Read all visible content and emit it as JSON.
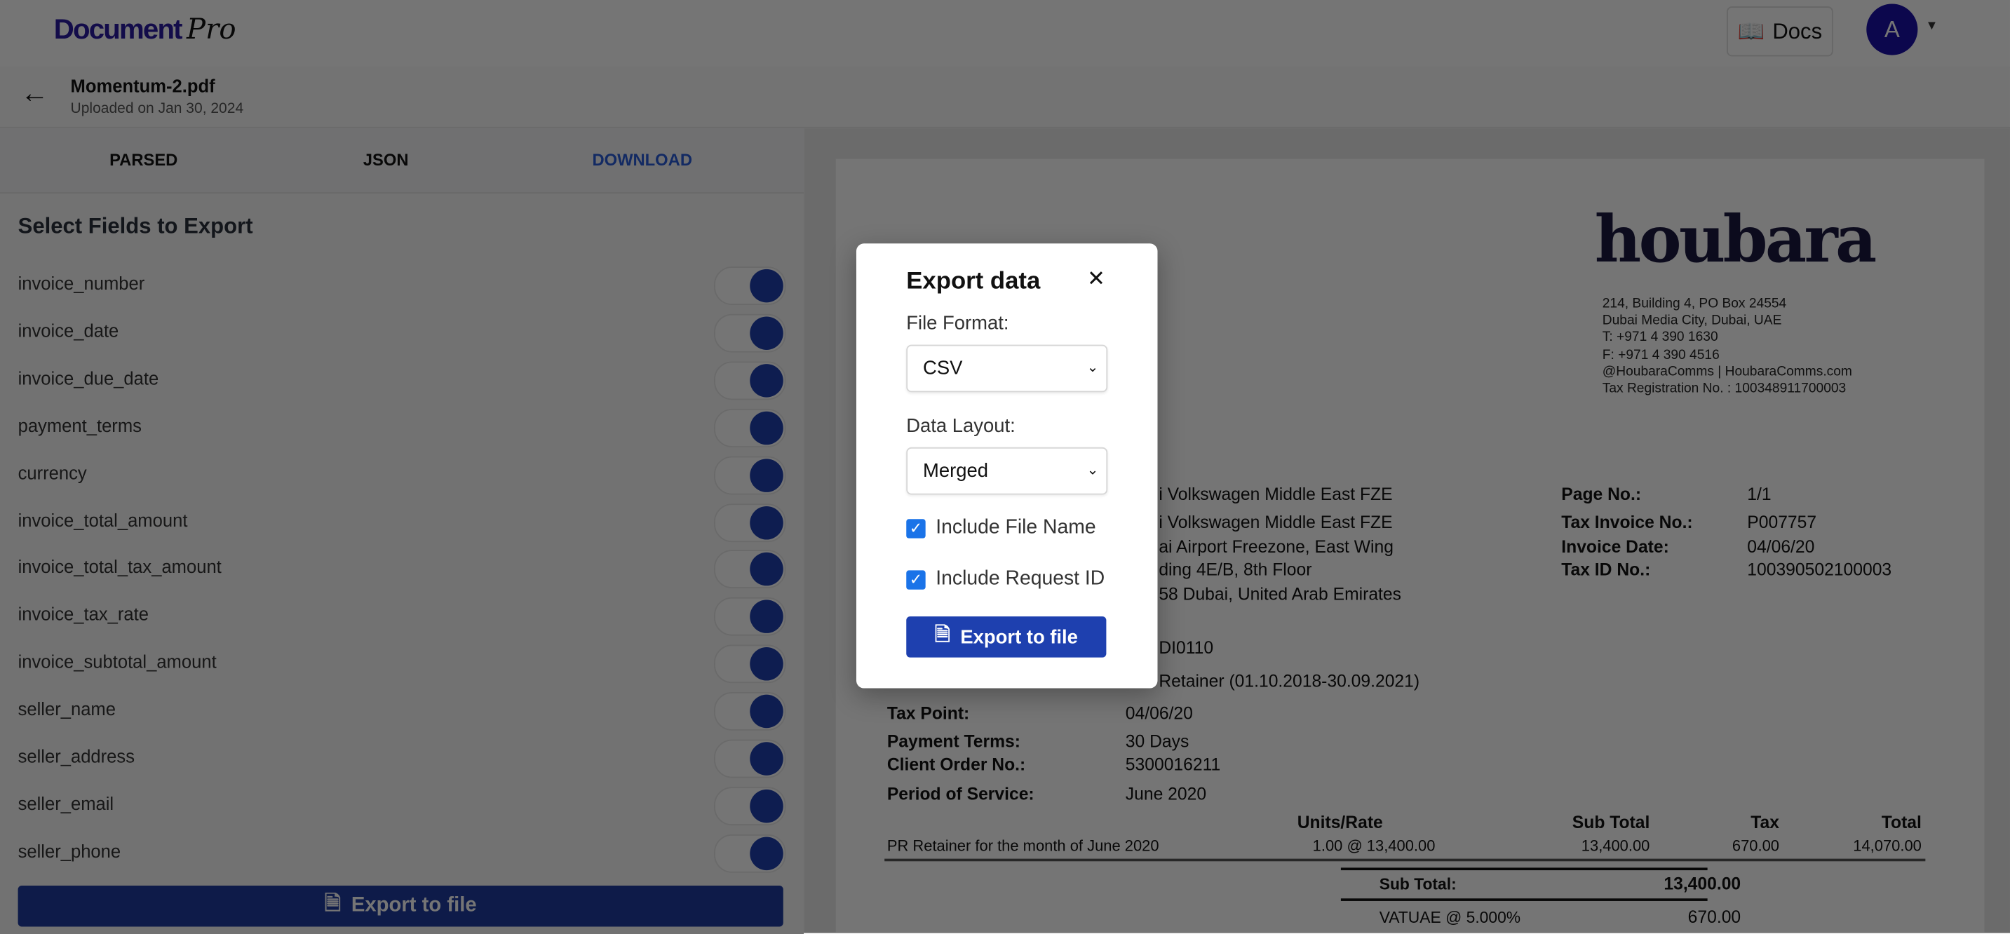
{
  "header": {
    "logo_main": "Document",
    "logo_script": "Pro",
    "docs_label": "Docs",
    "avatar_initial": "A"
  },
  "file": {
    "name": "Momentum-2.pdf",
    "uploaded": "Uploaded on Jan 30, 2024"
  },
  "tabs": [
    {
      "label": "PARSED"
    },
    {
      "label": "JSON"
    },
    {
      "label": "DOWNLOAD",
      "active": true
    }
  ],
  "fields_panel": {
    "title": "Select Fields to Export",
    "export_label": "Export to file",
    "fields": [
      {
        "name": "invoice_number",
        "enabled": true
      },
      {
        "name": "invoice_date",
        "enabled": true
      },
      {
        "name": "invoice_due_date",
        "enabled": true
      },
      {
        "name": "payment_terms",
        "enabled": true
      },
      {
        "name": "currency",
        "enabled": true
      },
      {
        "name": "invoice_total_amount",
        "enabled": true
      },
      {
        "name": "invoice_total_tax_amount",
        "enabled": true
      },
      {
        "name": "invoice_tax_rate",
        "enabled": true
      },
      {
        "name": "invoice_subtotal_amount",
        "enabled": true
      },
      {
        "name": "seller_name",
        "enabled": true
      },
      {
        "name": "seller_address",
        "enabled": true
      },
      {
        "name": "seller_email",
        "enabled": true
      },
      {
        "name": "seller_phone",
        "enabled": true
      }
    ]
  },
  "document": {
    "brand": "houbara",
    "address_lines": [
      "214, Building 4, PO Box 24554",
      "Dubai Media City, Dubai, UAE",
      "T: +971 4 390 1630",
      "F: +971 4 390 4516",
      "@HoubaraComms | HoubaraComms.com",
      "Tax Registration No. : 100348911700003"
    ],
    "client_lines": [
      "i Volkswagen Middle East FZE",
      "i Volkswagen Middle East FZE",
      "ai Airport Freezone, East Wing",
      "ding 4E/B, 8th Floor",
      "58 Dubai, United Arab Emirates"
    ],
    "ref": "DI0110",
    "description": "Retainer (01.10.2018-30.09.2021)",
    "meta": [
      {
        "label": "Page No.:",
        "value": "1/1"
      },
      {
        "label": "Tax Invoice No.:",
        "value": "P007757"
      },
      {
        "label": "Invoice Date:",
        "value": "04/06/20"
      },
      {
        "label": "Tax ID No.:",
        "value": "100390502100003"
      }
    ],
    "details": [
      {
        "label": "Tax Point:",
        "value": "04/06/20"
      },
      {
        "label": "Payment Terms:",
        "value": "30 Days"
      },
      {
        "label": "Client Order No.:",
        "value": "5300016211"
      },
      {
        "label": "Period of Service:",
        "value": "June 2020"
      }
    ],
    "table": {
      "headers": [
        "Units/Rate",
        "Sub Total",
        "Tax",
        "Total"
      ],
      "rows": [
        {
          "description": "PR Retainer for the month of June 2020",
          "units_rate": "1.00 @ 13,400.00",
          "sub_total": "13,400.00",
          "tax": "670.00",
          "total": "14,070.00"
        }
      ]
    },
    "totals": [
      {
        "label": "Sub Total:",
        "value": "13,400.00"
      },
      {
        "label": "VATUAE @ 5.000%",
        "value": "670.00"
      }
    ]
  },
  "modal": {
    "title": "Export data",
    "file_format_label": "File Format:",
    "file_format_value": "CSV",
    "data_layout_label": "Data Layout:",
    "data_layout_value": "Merged",
    "include_file_name": {
      "label": "Include File Name",
      "checked": true
    },
    "include_request_id": {
      "label": "Include Request ID",
      "checked": true
    },
    "export_label": "Export to file"
  },
  "colors": {
    "accent": "#1e40af",
    "logo": "#2a1aa0",
    "tab_active": "#2a5bd7"
  }
}
